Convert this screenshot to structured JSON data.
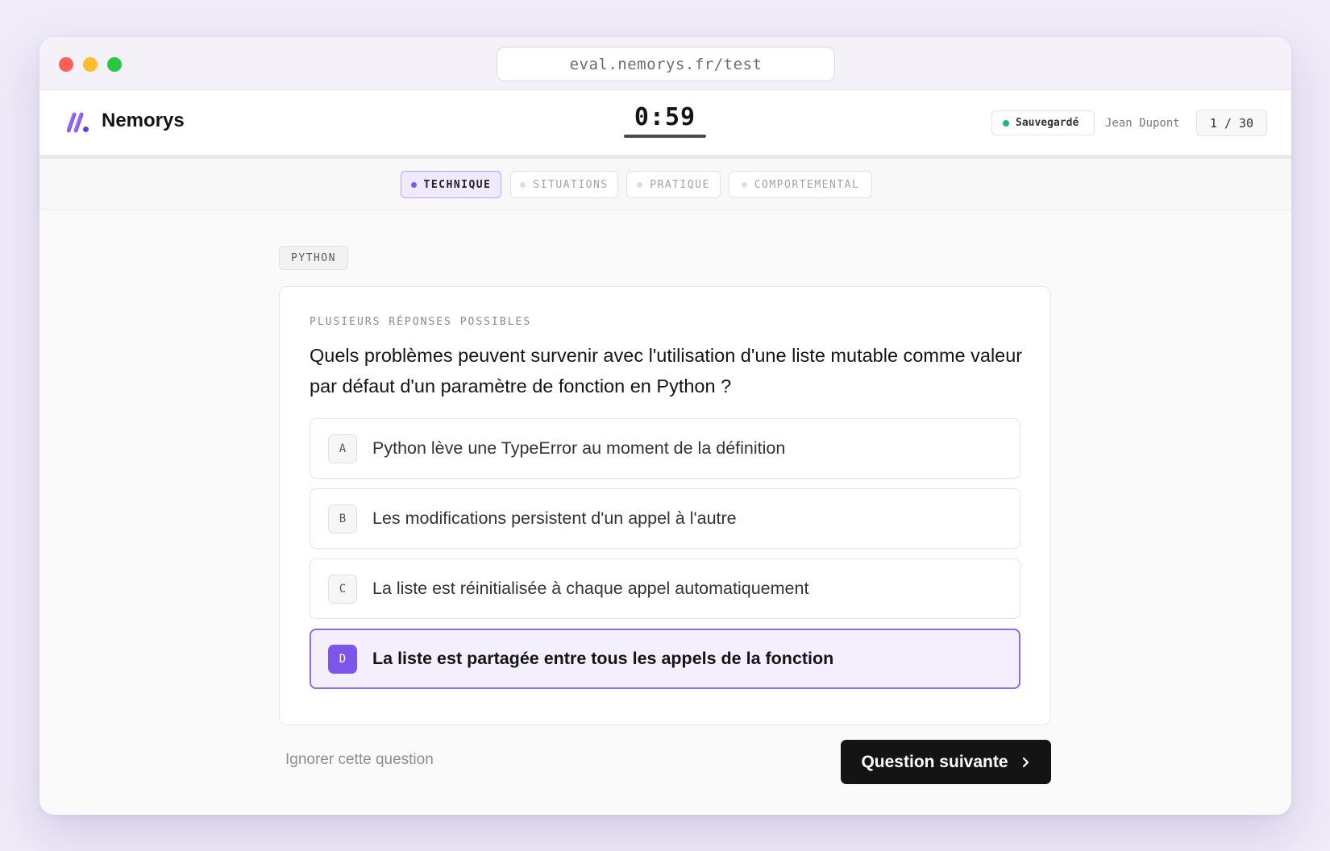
{
  "browser": {
    "url": "eval.nemorys.fr/test"
  },
  "header": {
    "brand": "Nemorys",
    "timer": "0:59",
    "saved_label": "Sauvegardé",
    "user_name": "Jean Dupont",
    "counter": "1 / 30"
  },
  "tabs": [
    {
      "label": "TECHNIQUE",
      "active": true
    },
    {
      "label": "SITUATIONS",
      "active": false
    },
    {
      "label": "PRATIQUE",
      "active": false
    },
    {
      "label": "COMPORTEMENTAL",
      "active": false
    }
  ],
  "question": {
    "topic": "PYTHON",
    "type_label": "PLUSIEURS RÉPONSES POSSIBLES",
    "text": "Quels problèmes peuvent survenir avec l'utilisation d'une liste mutable comme valeur par défaut d'un paramètre de fonction en Python ?",
    "options": [
      {
        "letter": "A",
        "text": "Python lève une TypeError au moment de la définition",
        "selected": false
      },
      {
        "letter": "B",
        "text": "Les modifications persistent d'un appel à l'autre",
        "selected": false
      },
      {
        "letter": "C",
        "text": "La liste est réinitialisée à chaque appel automatiquement",
        "selected": false
      },
      {
        "letter": "D",
        "text": "La liste est partagée entre tous les appels de la fonction",
        "selected": true
      }
    ]
  },
  "actions": {
    "skip_label": "Ignorer cette question",
    "next_label": "Question suivante",
    "next_icon": "chevron-right-icon"
  },
  "colors": {
    "accent": "#7c56e8",
    "saved_dot": "#22b573",
    "primary_button": "#141414"
  }
}
